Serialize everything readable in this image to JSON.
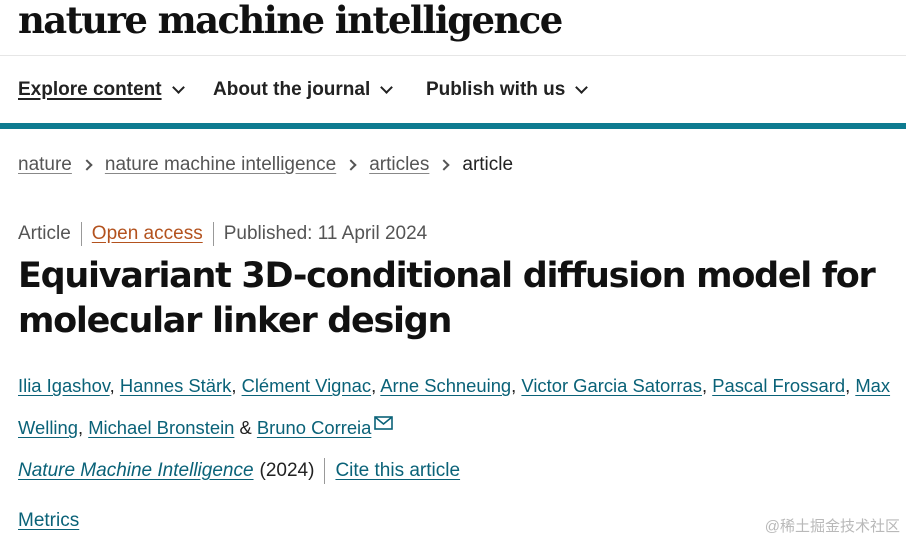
{
  "brand": {
    "logo_text": "nature machine intelligence"
  },
  "nav": {
    "items": [
      {
        "label": "Explore content"
      },
      {
        "label": "About the journal"
      },
      {
        "label": "Publish with us"
      }
    ]
  },
  "breadcrumb": {
    "items": [
      "nature",
      "nature machine intelligence",
      "articles"
    ],
    "current": "article"
  },
  "article": {
    "type": "Article",
    "access": "Open access",
    "published": "Published: 11 April 2024",
    "title": "Equivariant 3D-conditional diffusion model for molecular linker design",
    "authors": [
      "Ilia Igashov",
      "Hannes Stärk",
      "Clément Vignac",
      "Arne Schneuing",
      "Victor Garcia Satorras",
      "Pascal Frossard",
      "Max Welling",
      "Michael Bronstein",
      "Bruno Correia"
    ],
    "separator": ", ",
    "conjunction": " & ",
    "journal": "Nature Machine Intelligence",
    "year": "(2024)",
    "cite_label": "Cite this article",
    "metrics_label": "Metrics"
  },
  "watermark": "@稀土掘金技术社区",
  "colors": {
    "teal_rule": "#0e7b90",
    "link": "#0a6278",
    "open_access": "#b3521e"
  },
  "icons": {
    "nav_dropdown": "chevron-down-icon",
    "breadcrumb_sep": "chevron-right-icon",
    "corresponding_author": "mail-icon"
  }
}
